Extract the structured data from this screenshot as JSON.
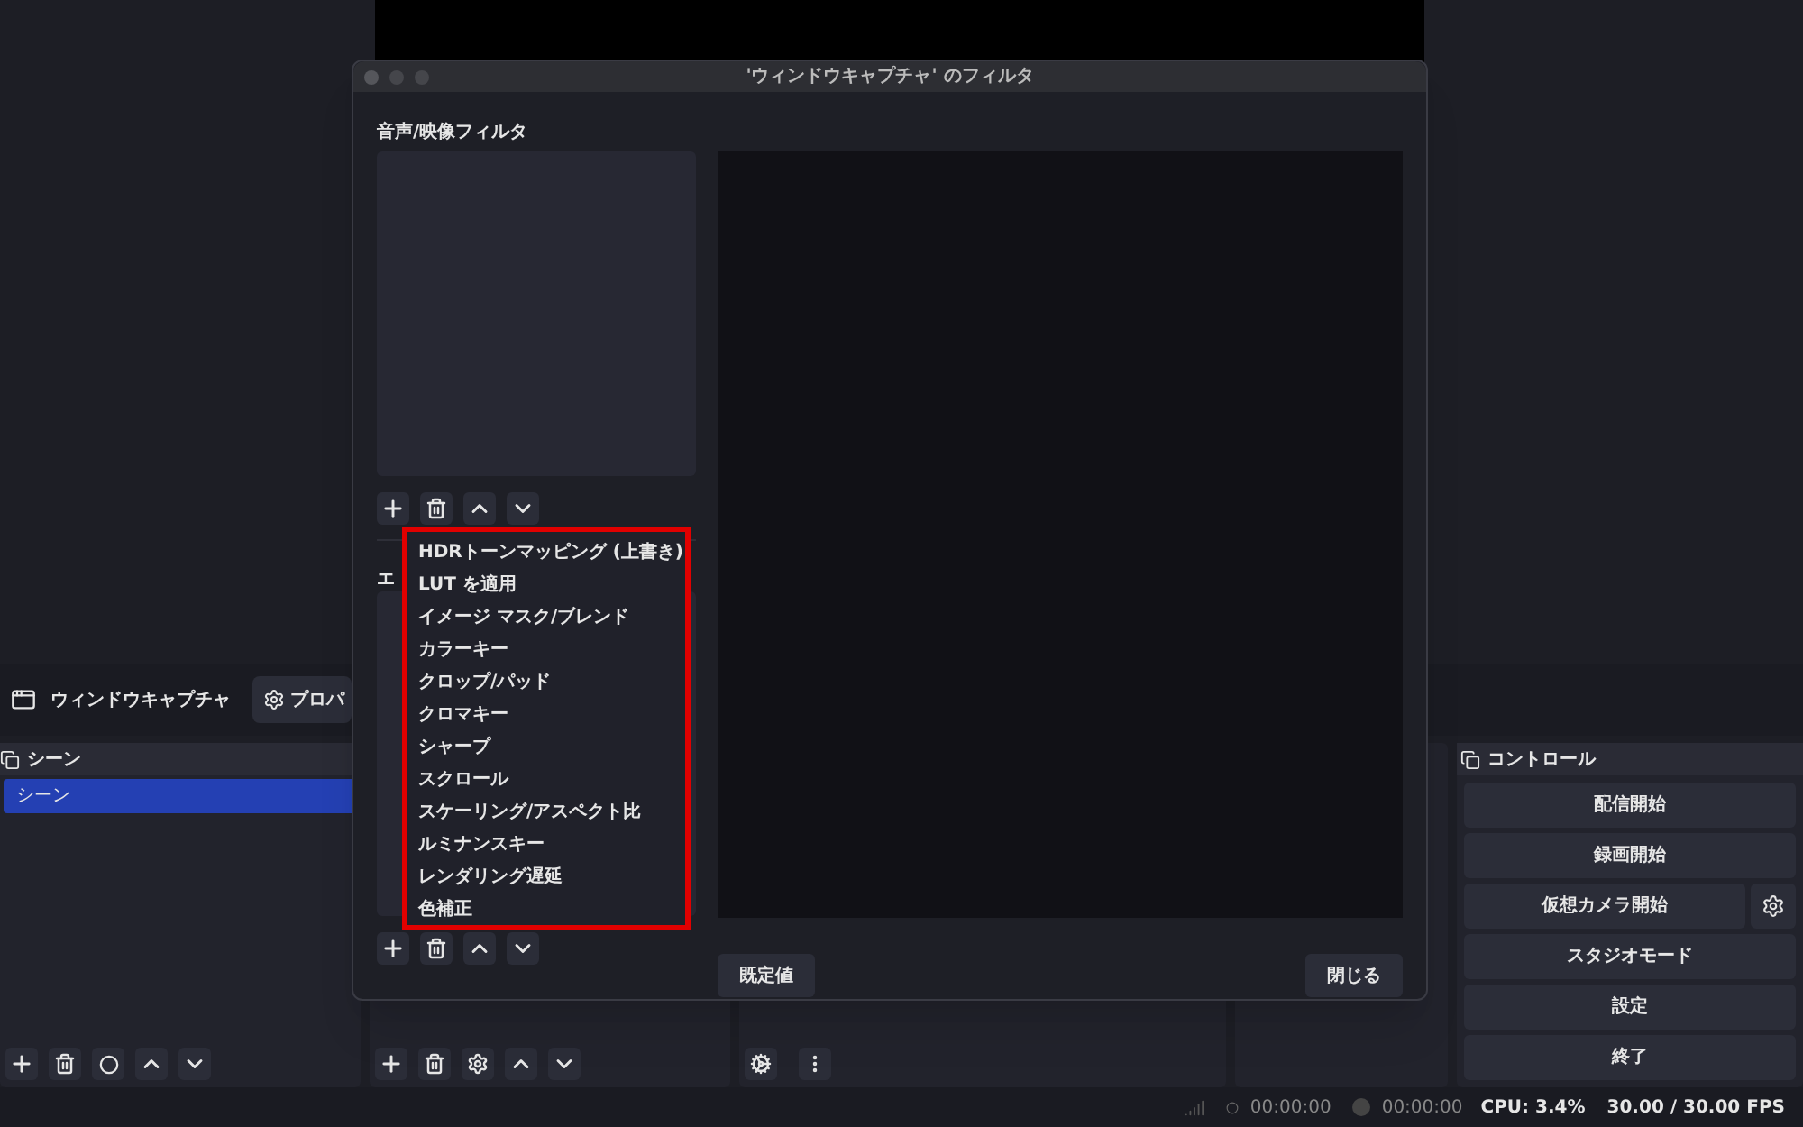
{
  "main": {
    "source_name": "ウィンドウキャプチャ",
    "properties_button": "プロパ",
    "scenes_dock": {
      "title": "シーン",
      "items": [
        {
          "label": "シーン",
          "selected": true
        }
      ]
    },
    "controls_dock": {
      "title": "コントロール",
      "buttons": [
        {
          "label": "配信開始",
          "kind": "plain"
        },
        {
          "label": "録画開始",
          "kind": "plain"
        },
        {
          "label": "仮想カメラ開始",
          "kind": "with_settings"
        },
        {
          "label": "スタジオモード",
          "kind": "plain"
        },
        {
          "label": "設定",
          "kind": "plain"
        },
        {
          "label": "終了",
          "kind": "plain"
        }
      ]
    },
    "status_bar": {
      "streaming_time": "00:00:00",
      "recording_time": "00:00:00",
      "cpu": "CPU: 3.4%",
      "fps": "30.00 / 30.00 FPS"
    }
  },
  "dialog": {
    "title": "'ウィンドウキャプチャ' のフィルタ",
    "audio_video_filters_label": "音声/映像フィルタ",
    "effect_filters_label": "エ",
    "menu": {
      "items": [
        "HDRトーンマッピング (上書き)",
        "LUT を適用",
        "イメージ マスク/ブレンド",
        "カラーキー",
        "クロップ/パッド",
        "クロマキー",
        "シャープ",
        "スクロール",
        "スケーリング/アスペクト比",
        "ルミナンスキー",
        "レンダリング遅延",
        "色補正"
      ]
    },
    "defaults_button": "既定値",
    "close_button": "閉じる"
  }
}
